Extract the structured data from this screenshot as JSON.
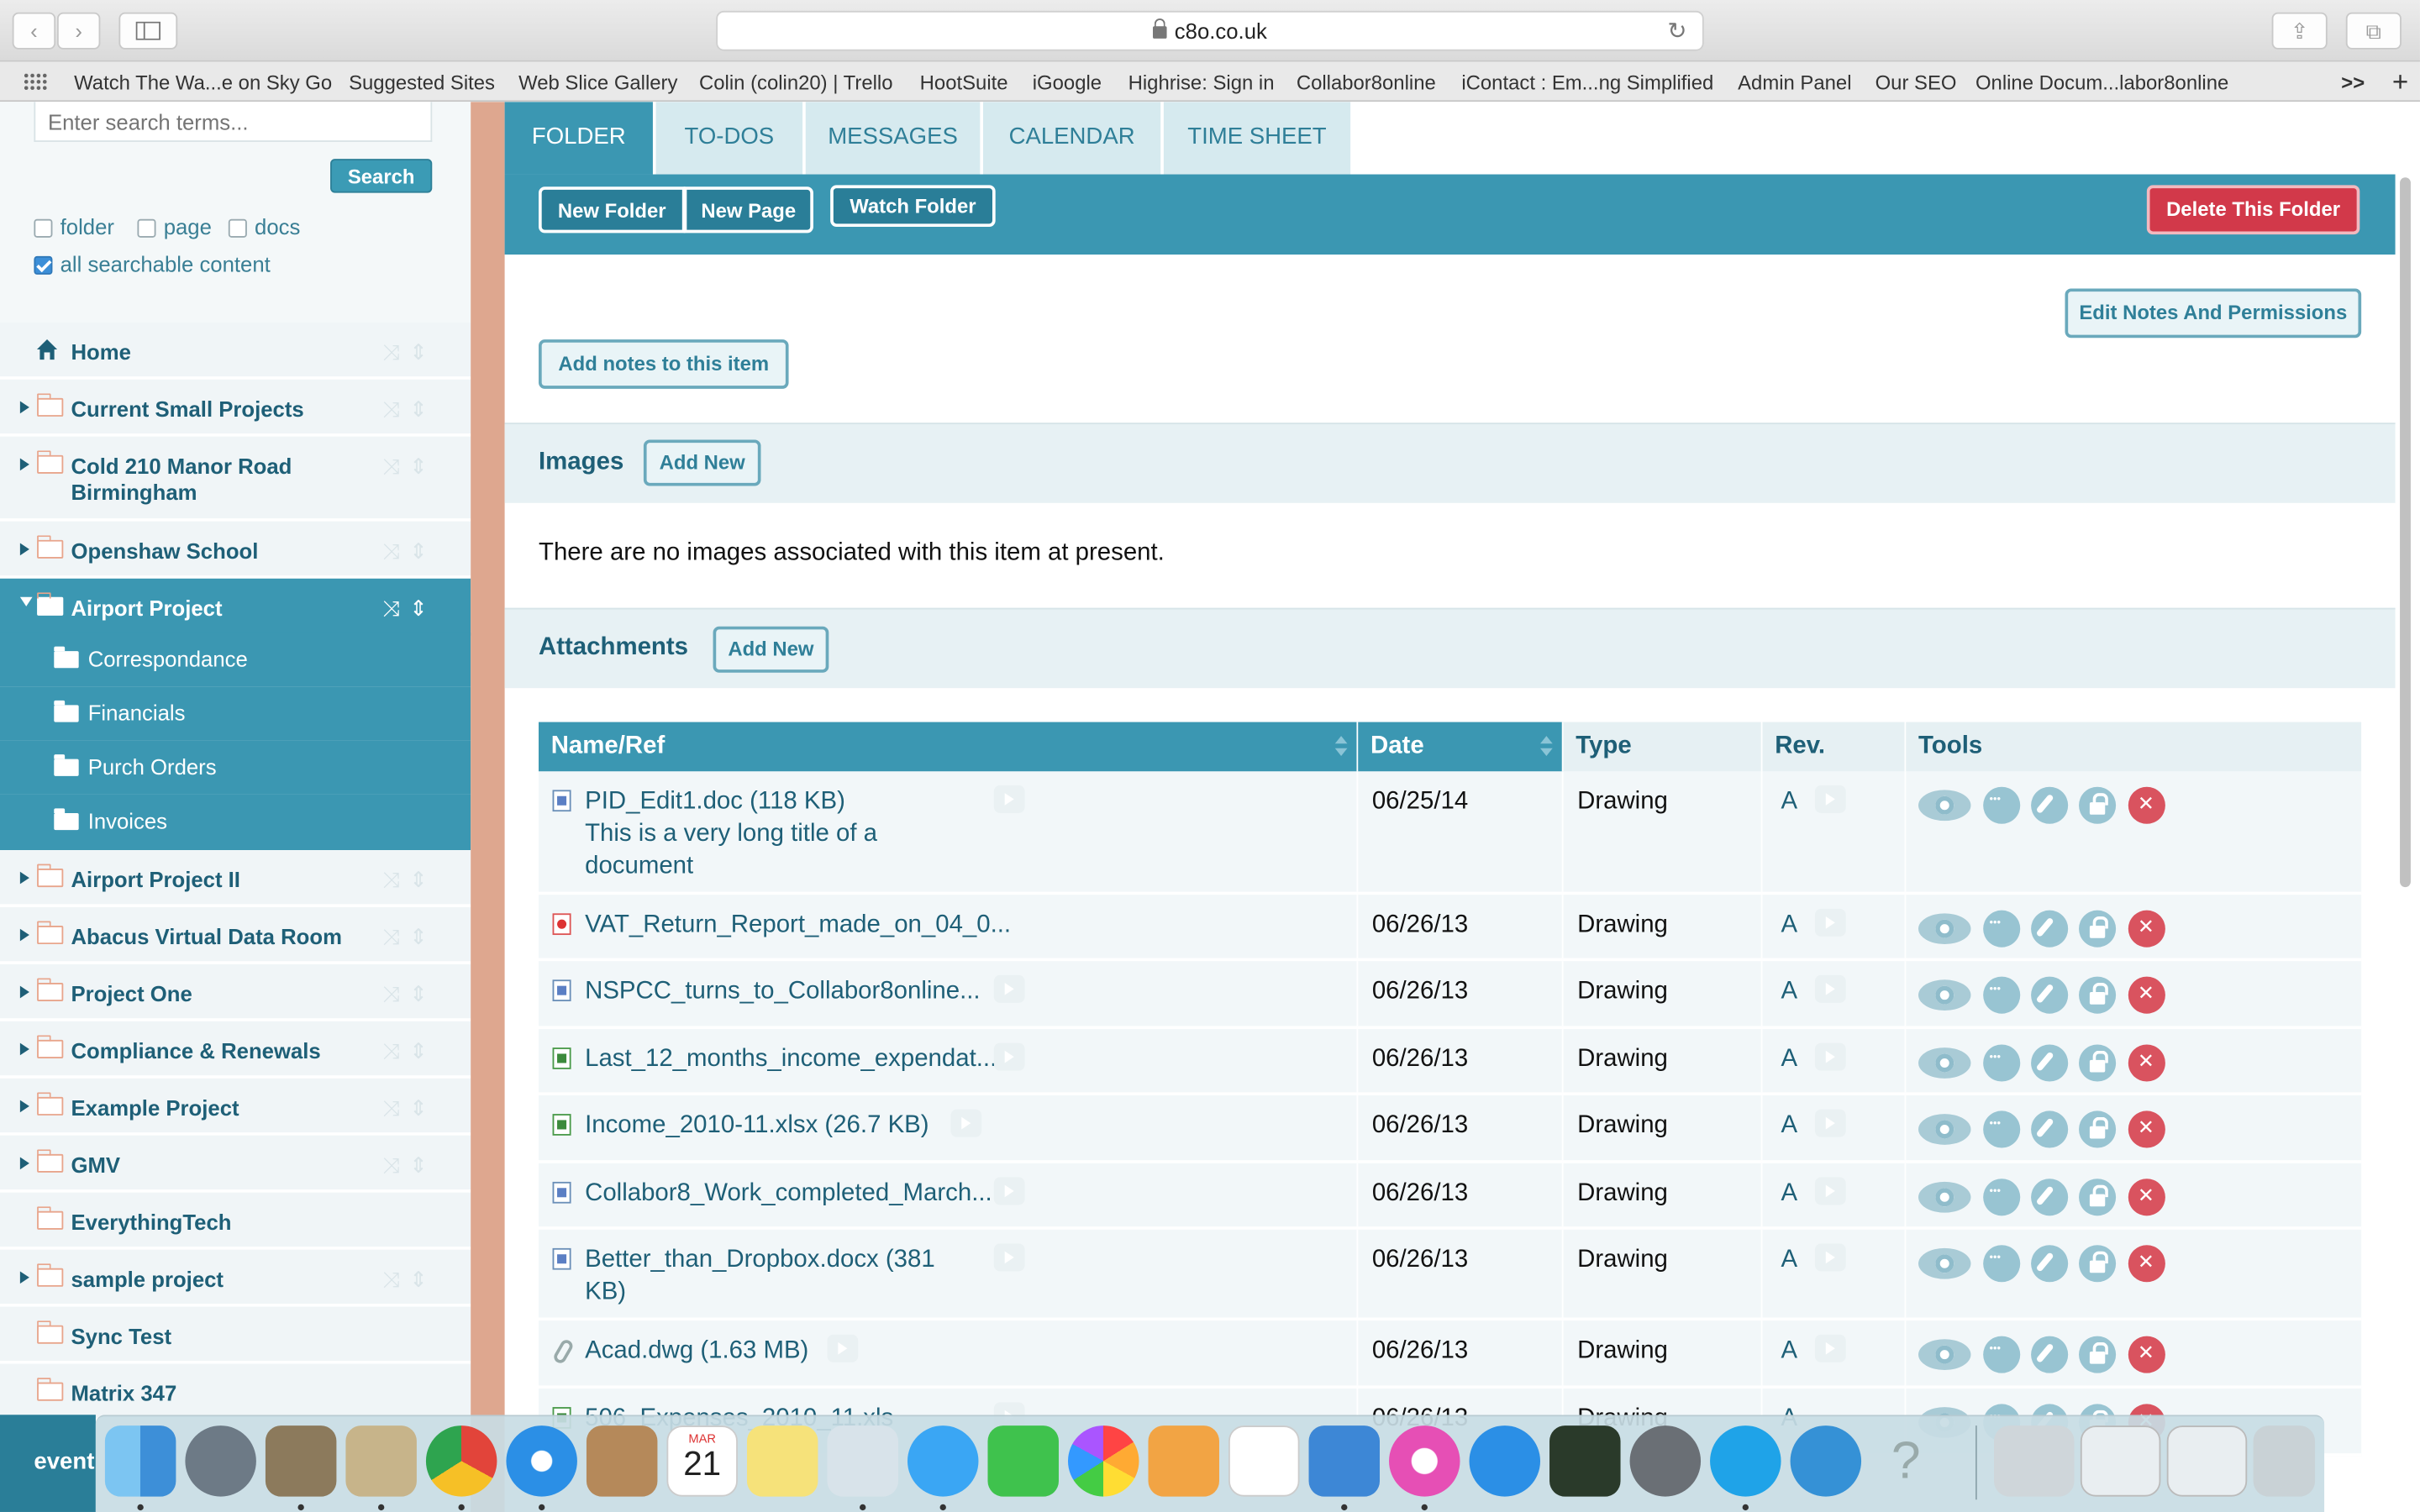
{
  "browser": {
    "url": "c8o.co.uk",
    "bookmarks": [
      "Watch The Wa...e on Sky Go",
      "Suggested Sites",
      "Web Slice Gallery",
      "Colin (colin20) | Trello",
      "HootSuite",
      "iGoogle",
      "Highrise: Sign in",
      "Collabor8online",
      "iContact : Em...ng Simplified",
      "Admin Panel",
      "Our SEO",
      "Online Docum...labor8online"
    ],
    "overflow_label": ">>",
    "new_tab_label": "+"
  },
  "sidebar": {
    "search_placeholder": "Enter search terms...",
    "search_button": "Search",
    "filters": [
      {
        "label": "folder",
        "checked": false
      },
      {
        "label": "page",
        "checked": false
      },
      {
        "label": "docs",
        "checked": false
      },
      {
        "label": "all searchable content",
        "checked": true
      }
    ],
    "home_label": "Home",
    "items": [
      {
        "label": "Current Small Projects"
      },
      {
        "label": "Cold 210 Manor Road Birmingham"
      },
      {
        "label": "Openshaw School"
      },
      {
        "label": "Airport Project",
        "active": true
      },
      {
        "label": "Airport Project II"
      },
      {
        "label": "Abacus Virtual Data Room"
      },
      {
        "label": "Project One"
      },
      {
        "label": "Compliance & Renewals"
      },
      {
        "label": "Example Project"
      },
      {
        "label": "GMV"
      },
      {
        "label": "EverythingTech"
      },
      {
        "label": "sample project"
      },
      {
        "label": "Sync Test"
      },
      {
        "label": "Matrix 347"
      }
    ],
    "subfolders": [
      "Correspondance",
      "Financials",
      "Purch Orders",
      "Invoices"
    ],
    "bottom_label": "event"
  },
  "main": {
    "tabs": [
      "FOLDER",
      "TO-DOS",
      "MESSAGES",
      "CALENDAR",
      "TIME SHEET"
    ],
    "active_tab": "FOLDER",
    "toolbar": {
      "new_folder": "New Folder",
      "new_page": "New Page",
      "watch_folder": "Watch Folder",
      "delete_folder": "Delete This Folder"
    },
    "edit_notes": "Edit Notes And Permissions",
    "add_notes": "Add notes to this item",
    "images": {
      "title": "Images",
      "add_new": "Add New",
      "empty_message": "There are no images associated with this item at present."
    },
    "attachments": {
      "title": "Attachments",
      "add_new": "Add New",
      "columns": [
        "Name/Ref",
        "Date",
        "Type",
        "Rev.",
        "Tools"
      ],
      "rows": [
        {
          "name": "PID_Edit1.doc (118 KB)",
          "subtitle": "This is a very long title of a",
          "subtitle2": "document",
          "date": "06/25/14",
          "type": "Drawing",
          "rev": "A",
          "icon": "doc"
        },
        {
          "name": "VAT_Return_Report_made_on_04_0...",
          "date": "06/26/13",
          "type": "Drawing",
          "rev": "A",
          "icon": "pdf"
        },
        {
          "name": "NSPCC_turns_to_Collabor8online...",
          "date": "06/26/13",
          "type": "Drawing",
          "rev": "A",
          "icon": "doc"
        },
        {
          "name": "Last_12_months_income_expendat...",
          "date": "06/26/13",
          "type": "Drawing",
          "rev": "A",
          "icon": "xls"
        },
        {
          "name": "Income_2010-11.xlsx (26.7 KB)",
          "date": "06/26/13",
          "type": "Drawing",
          "rev": "A",
          "icon": "xls"
        },
        {
          "name": "Collabor8_Work_completed_March...",
          "date": "06/26/13",
          "type": "Drawing",
          "rev": "A",
          "icon": "doc"
        },
        {
          "name": "Better_than_Dropbox.docx (381",
          "subtitle": "KB)",
          "date": "06/26/13",
          "type": "Drawing",
          "rev": "A",
          "icon": "doc"
        },
        {
          "name": "Acad.dwg (1.63 MB)",
          "date": "06/26/13",
          "type": "Drawing",
          "rev": "A",
          "icon": "clip"
        },
        {
          "name": "506_Expenses_2010_11.xls",
          "date": "06/26/13",
          "type": "Drawing",
          "rev": "A",
          "icon": "xls"
        }
      ]
    }
  },
  "dock": {
    "calendar_month": "MAR",
    "calendar_day": "21",
    "icons": [
      "finder-icon",
      "launchpad-icon",
      "gimp-icon",
      "preview-icon",
      "chrome-icon",
      "safari-icon",
      "contacts-icon",
      "calendar-icon",
      "notes-icon",
      "photo-preview-icon",
      "messages-icon",
      "facetime-icon",
      "photos-icon",
      "pages-icon",
      "numbers-icon",
      "keynote-icon",
      "itunes-icon",
      "app-store-icon",
      "evernote-icon",
      "system-preferences-icon",
      "skype-icon",
      "vlc-like-icon",
      "help-icon"
    ]
  }
}
